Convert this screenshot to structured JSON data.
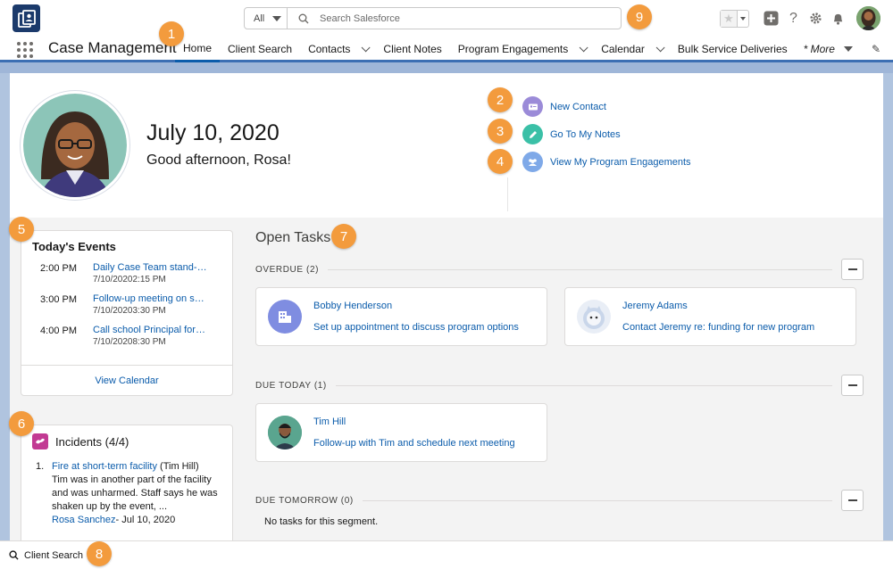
{
  "header": {
    "search_scope": "All",
    "search_placeholder": "Search Salesforce"
  },
  "nav": {
    "app_name": "Case Management",
    "tabs": [
      {
        "label": "Home",
        "active": true,
        "dropdown": false
      },
      {
        "label": "Client Search",
        "dropdown": false
      },
      {
        "label": "Contacts",
        "dropdown": true
      },
      {
        "label": "Client Notes",
        "dropdown": false
      },
      {
        "label": "Program Engagements",
        "dropdown": true
      },
      {
        "label": "Calendar",
        "dropdown": true
      },
      {
        "label": "Bulk Service Deliveries",
        "dropdown": false
      }
    ],
    "more_label": "* More"
  },
  "profile": {
    "date": "July 10, 2020",
    "greeting": "Good afternoon, Rosa!",
    "quick_links": [
      {
        "label": "New Contact",
        "icon": "contact-card-icon",
        "color": "#9b8bd8"
      },
      {
        "label": "Go To My Notes",
        "icon": "pencil-icon",
        "color": "#3bc0a7"
      },
      {
        "label": "View My Program Engagements",
        "icon": "people-icon",
        "color": "#7fa9e8"
      }
    ]
  },
  "events": {
    "title": "Today's Events",
    "items": [
      {
        "time": "2:00 PM",
        "name": "Daily Case Team stand-up",
        "sub": "7/10/20202:15 PM"
      },
      {
        "time": "3:00 PM",
        "name": "Follow-up meeting on sh...",
        "sub": "7/10/20203:30 PM"
      },
      {
        "time": "4:00 PM",
        "name": "Call school Principal for i...",
        "sub": "7/10/20208:30 PM"
      }
    ],
    "view_calendar": "View Calendar"
  },
  "incidents": {
    "title": "Incidents (4/4)",
    "items": [
      {
        "num": "1.",
        "link": "Fire at short-term facility",
        "who": " (Tim Hill)",
        "text": "Tim was in another part of the facility and was unharmed. Staff says he was shaken up by the event, ...",
        "author": "Rosa Sanchez",
        "date": "- Jul 10, 2020"
      }
    ]
  },
  "tasks": {
    "title": "Open Tasks",
    "sections": [
      {
        "label": "OVERDUE (2)",
        "items": [
          {
            "name": "Bobby Henderson",
            "desc": "Set up appointment to discuss program options",
            "avatar": "building-icon"
          },
          {
            "name": "Jeremy Adams",
            "desc": "Contact Jeremy re: funding for new program",
            "avatar": "astro-avatar"
          }
        ]
      },
      {
        "label": "DUE TODAY (1)",
        "items": [
          {
            "name": "Tim Hill",
            "desc": "Follow-up with Tim and schedule next meeting",
            "avatar": "person-avatar"
          }
        ]
      },
      {
        "label": "DUE TOMORROW (0)",
        "empty_text": "No tasks for this segment."
      }
    ]
  },
  "utility": {
    "label": "Client Search"
  },
  "callouts": [
    "1",
    "2",
    "3",
    "4",
    "5",
    "6",
    "7",
    "8",
    "9"
  ]
}
